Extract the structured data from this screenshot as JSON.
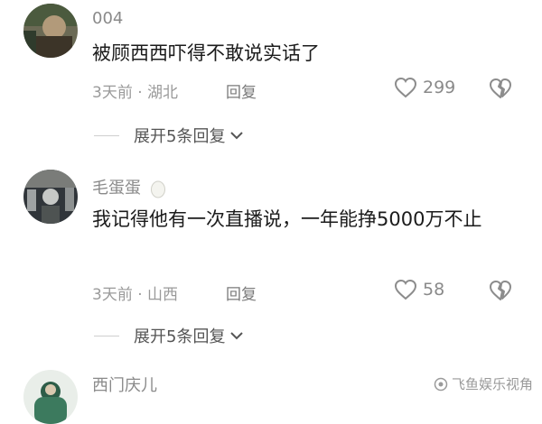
{
  "comments": [
    {
      "username": "004",
      "text": "被顾西西吓得不敢说实话了",
      "time": "3天前",
      "location": "湖北",
      "reply_label": "回复",
      "likes": "299",
      "expand_label": "展开5条回复"
    },
    {
      "username": "毛蛋蛋",
      "text": "我记得他有一次直播说，一年能挣5000万不止",
      "time": "3天前",
      "location": "山西",
      "reply_label": "回复",
      "likes": "58",
      "expand_label": "展开5条回复"
    },
    {
      "username": "西门庆儿"
    }
  ],
  "meta_separator": "·",
  "watermark": "飞鱼娱乐视角",
  "icons": {
    "like": "heart-outline-icon",
    "dislike": "broken-heart-icon",
    "expand": "chevron-down-icon",
    "badge": "egg-icon",
    "watermark": "camera-shutter-icon"
  }
}
